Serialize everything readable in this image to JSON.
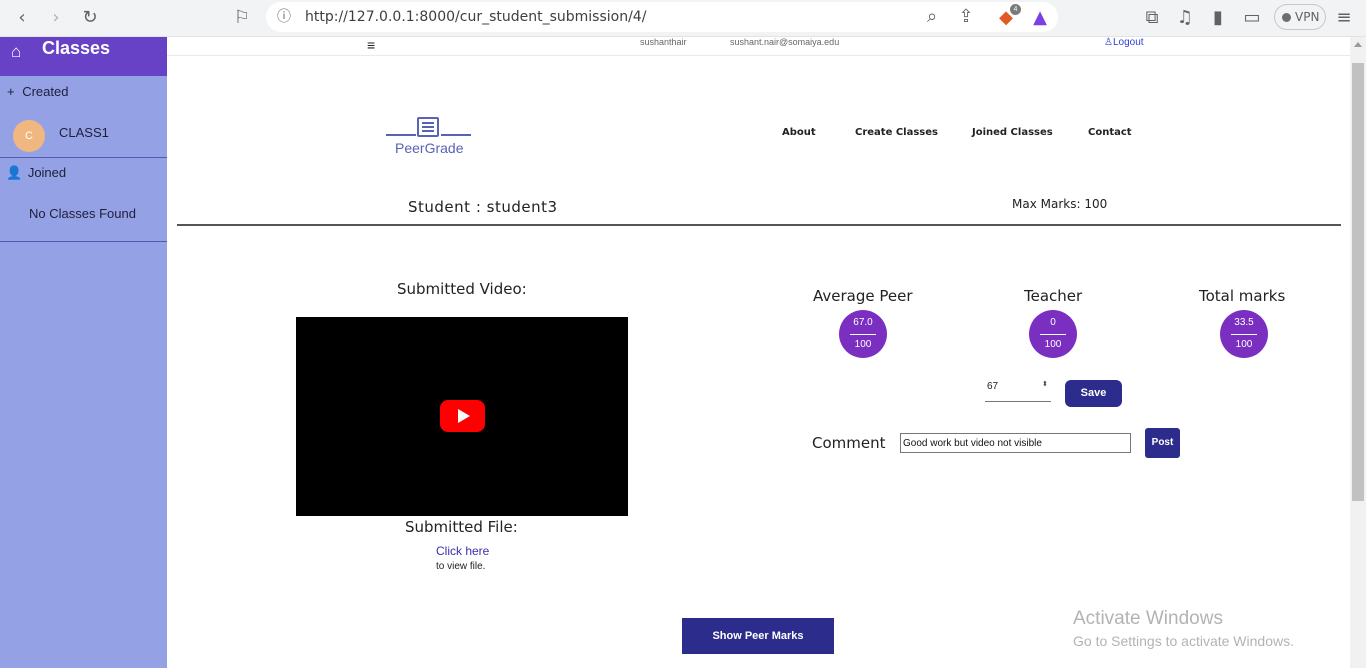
{
  "browser": {
    "url": "http://127.0.0.1:8000/cur_student_submission/4/",
    "brave_badge": "4",
    "vpn_label": "VPN"
  },
  "sidebar": {
    "title": "Classes",
    "created_label": "Created",
    "created_items": [
      {
        "avatar_letter": "C",
        "name": "CLASS1"
      }
    ],
    "joined_label": "Joined",
    "joined_empty": "No Classes Found"
  },
  "topstrip": {
    "hamburger": "≡",
    "username": "sushanthair",
    "email": "sushant.nair@somaiya.edu",
    "logout": "Logout"
  },
  "navbar": {
    "logo_text": "PeerGrade",
    "links": [
      "About",
      "Create Classes",
      "Joined Classes",
      "Contact"
    ]
  },
  "submission": {
    "student_label": "Student : student3",
    "max_marks": "Max Marks: 100",
    "video_label": "Submitted Video:",
    "file_label": "Submitted File:",
    "file_link": "Click here",
    "file_suffix": "to view file."
  },
  "marks": [
    {
      "label": "Average Peer",
      "value": "67.0",
      "max": "100"
    },
    {
      "label": "Teacher",
      "value": "0",
      "max": "100"
    },
    {
      "label": "Total marks",
      "value": "33.5",
      "max": "100"
    }
  ],
  "grading": {
    "input_value": "67",
    "save_label": "Save",
    "comment_label": "Comment",
    "comment_value": "Good work but video not visible",
    "post_label": "Post",
    "show_peer_label": "Show Peer Marks"
  },
  "watermark": {
    "line1": "Activate Windows",
    "line2": "Go to Settings to activate Windows."
  },
  "colors": {
    "sidebar_bg": "#94a2e5",
    "sidebar_head": "#6741c6",
    "accent_button": "#2c2c8c",
    "mark_circle": "#7b2fc0"
  }
}
